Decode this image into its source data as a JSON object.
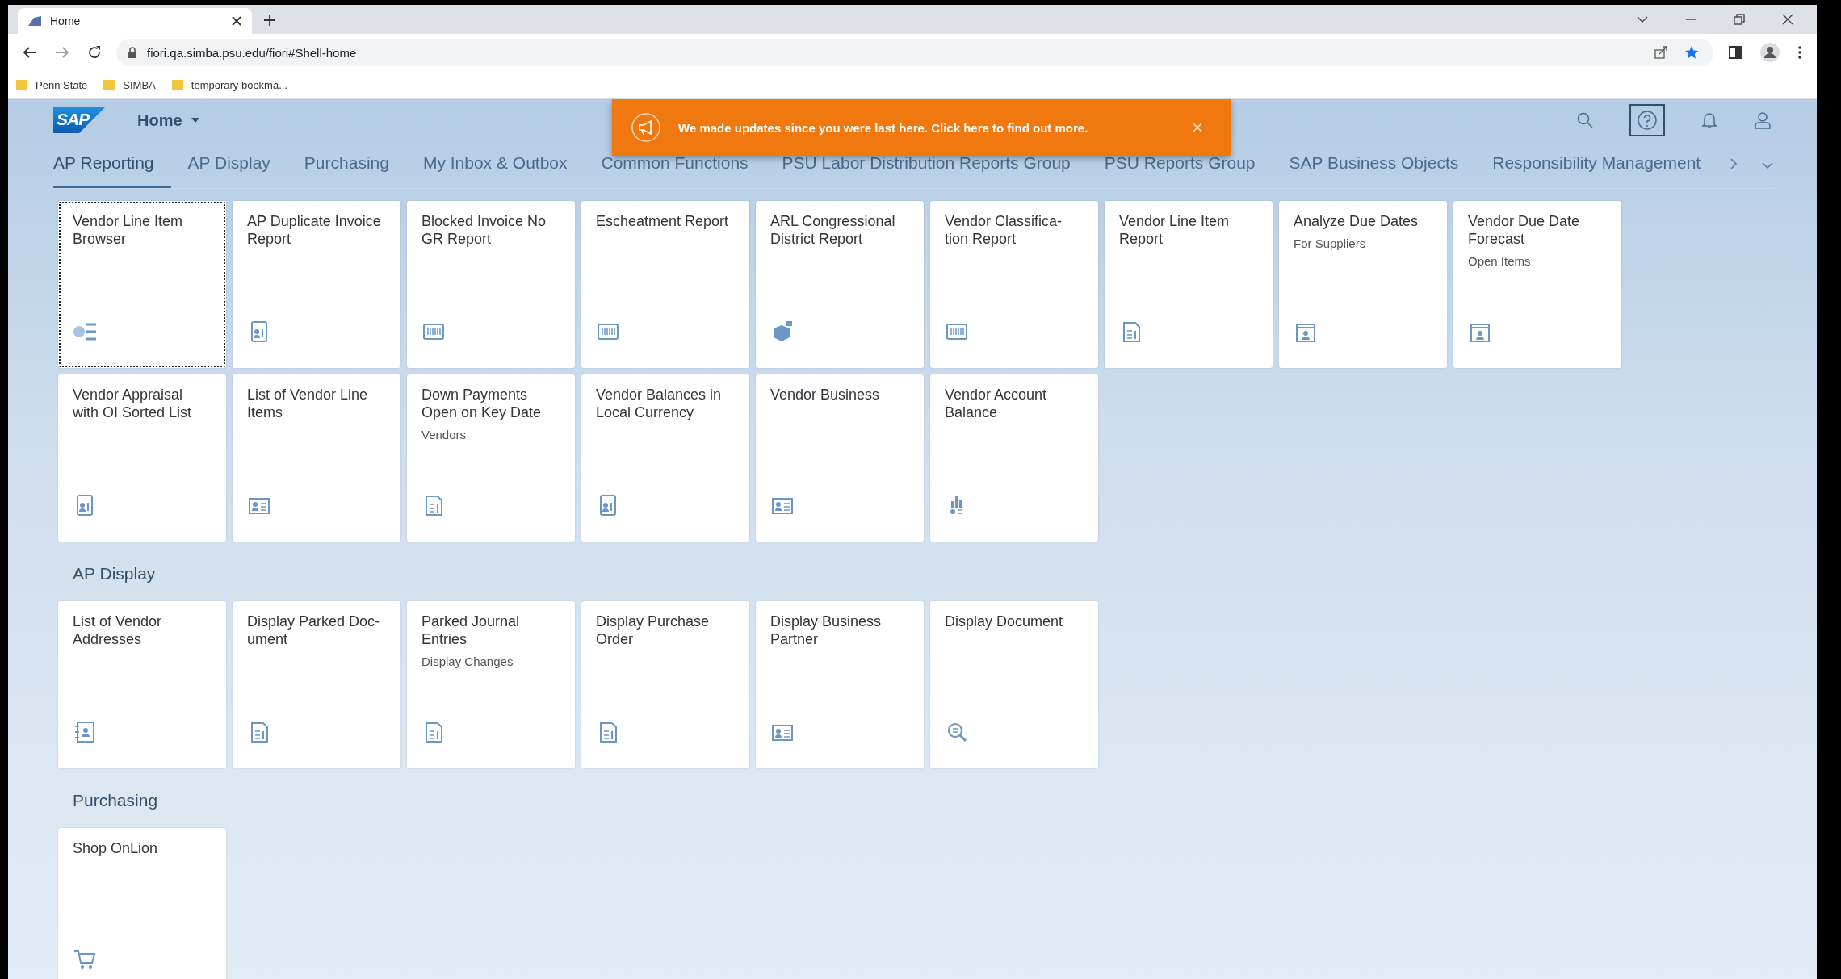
{
  "browser": {
    "tab": {
      "title": "Home"
    },
    "url": "fiori.qa.simba.psu.edu/fiori#Shell-home",
    "bookmarks": [
      {
        "label": "Penn State"
      },
      {
        "label": "SIMBA"
      },
      {
        "label": "temporary bookma..."
      }
    ]
  },
  "shell": {
    "logo": "SAP",
    "title": "Home",
    "tabs": [
      {
        "label": "AP Reporting",
        "selected": true
      },
      {
        "label": "AP Display",
        "selected": false
      },
      {
        "label": "Purchasing",
        "selected": false
      },
      {
        "label": "My Inbox & Outbox",
        "selected": false
      },
      {
        "label": "Common Functions",
        "selected": false
      },
      {
        "label": "PSU Labor Distribution Reports Group",
        "selected": false
      },
      {
        "label": "PSU Reports Group",
        "selected": false
      },
      {
        "label": "SAP Business Objects",
        "selected": false
      },
      {
        "label": "Responsibility Management",
        "selected": false
      }
    ]
  },
  "notification": {
    "message": "We made updates since you were last here. Click here to find out more."
  },
  "groups": [
    {
      "tiles": [
        {
          "title": "Vendor Line Item Browser",
          "kind": "list",
          "focused": true
        },
        {
          "title": "AP Duplicate Invoice Report",
          "kind": "id",
          "focused": false
        },
        {
          "title": "Blocked Invoice No GR Report",
          "kind": "barcode",
          "focused": false
        },
        {
          "title": "Escheatment Report",
          "kind": "barcode",
          "focused": false
        },
        {
          "title": "ARL Congressional District Report",
          "kind": "box",
          "focused": false
        },
        {
          "title": "Vendor Classifica-tion Report",
          "kind": "barcode",
          "focused": false
        },
        {
          "title": "Vendor Line Item Report",
          "kind": "doc",
          "focused": false
        },
        {
          "title": "Analyze Due Dates",
          "subtitle": "For Suppliers",
          "kind": "calendar",
          "focused": false
        },
        {
          "title": "Vendor Due Date Forecast",
          "subtitle": "Open Items",
          "kind": "calendar",
          "focused": false
        },
        {
          "title": "Vendor Appraisal with OI Sorted List",
          "kind": "id",
          "focused": false
        },
        {
          "title": "List of Vendor Line Items",
          "kind": "card",
          "focused": false
        },
        {
          "title": "Down Payments Open on Key Date",
          "subtitle": "Vendors",
          "kind": "doc",
          "focused": false
        },
        {
          "title": "Vendor Balances in Local Currency",
          "kind": "id",
          "focused": false
        },
        {
          "title": "Vendor Business",
          "kind": "card",
          "focused": false
        },
        {
          "title": "Vendor Account Balance",
          "kind": "chart",
          "focused": false
        }
      ]
    },
    {
      "title": "AP Display",
      "tiles": [
        {
          "title": "List of Vendor Addresses",
          "kind": "address",
          "focused": false
        },
        {
          "title": "Display Parked Doc-ument",
          "kind": "doc",
          "focused": false
        },
        {
          "title": "Parked Journal Entries",
          "subtitle": "Display Changes",
          "kind": "doc",
          "focused": false
        },
        {
          "title": "Display Purchase Order",
          "kind": "doc",
          "focused": false
        },
        {
          "title": "Display Business Partner",
          "kind": "card",
          "focused": false
        },
        {
          "title": "Display Document",
          "kind": "search",
          "focused": false
        }
      ]
    },
    {
      "title": "Purchasing",
      "tiles": [
        {
          "title": "Shop OnLion",
          "kind": "cart",
          "focused": false
        }
      ]
    }
  ]
}
